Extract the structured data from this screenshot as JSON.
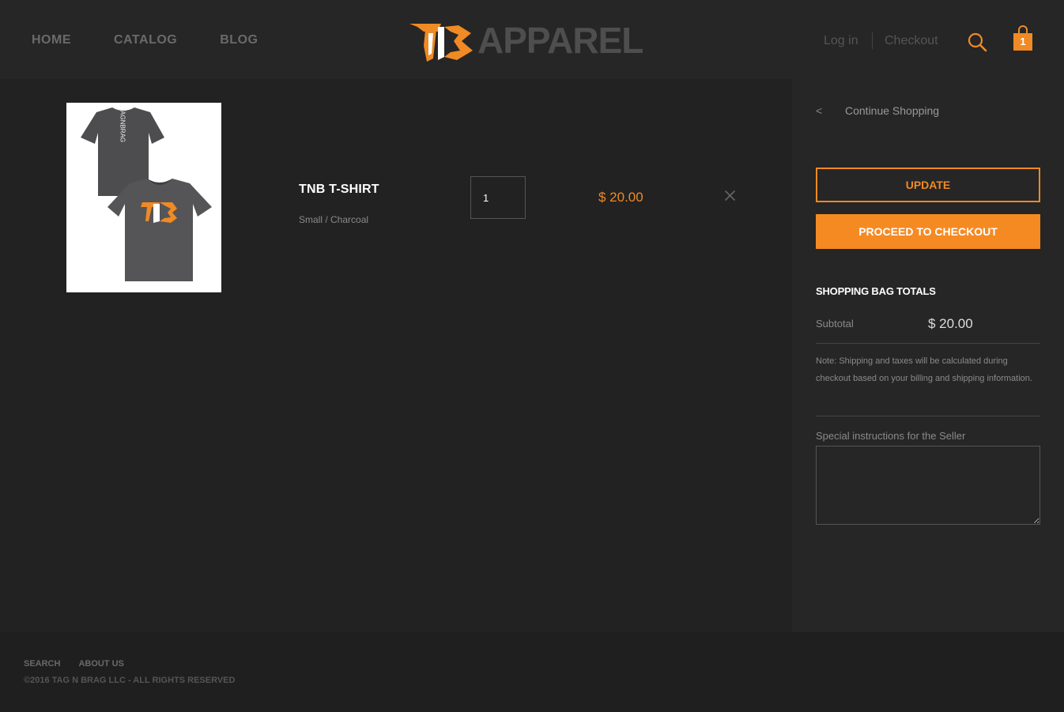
{
  "header": {
    "nav": [
      "HOME",
      "CATALOG",
      "BLOG"
    ],
    "logo_text": "APPAREL",
    "login": "Log in",
    "checkout": "Checkout",
    "cart_count": "1",
    "accent": "#f08a24"
  },
  "cart": {
    "item": {
      "name": "TNB T-SHIRT",
      "variant": "Small / Charcoal",
      "quantity": "1",
      "price": "$ 20.00",
      "image_back_text": "TAGNBRAG",
      "image_front_logo": "TNB"
    }
  },
  "sidebar": {
    "continue_chevron": "<",
    "continue_label": "Continue Shopping",
    "update_label": "UPDATE",
    "checkout_label": "PROCEED TO CHECKOUT",
    "totals_title": "SHOPPING BAG TOTALS",
    "subtotal_label": "Subtotal",
    "subtotal_value": "$ 20.00",
    "note": "Note: Shipping and taxes will be calculated during checkout based on your billing and shipping information.",
    "instructions_label": "Special instructions for the Seller"
  },
  "footer": {
    "links": [
      "SEARCH",
      "ABOUT US"
    ],
    "copyright": "©2016 TAG N BRAG LLC - ALL RIGHTS RESERVED"
  },
  "icons": {
    "search": "search-icon",
    "cart": "shopping-bag-icon",
    "remove": "close-icon"
  }
}
